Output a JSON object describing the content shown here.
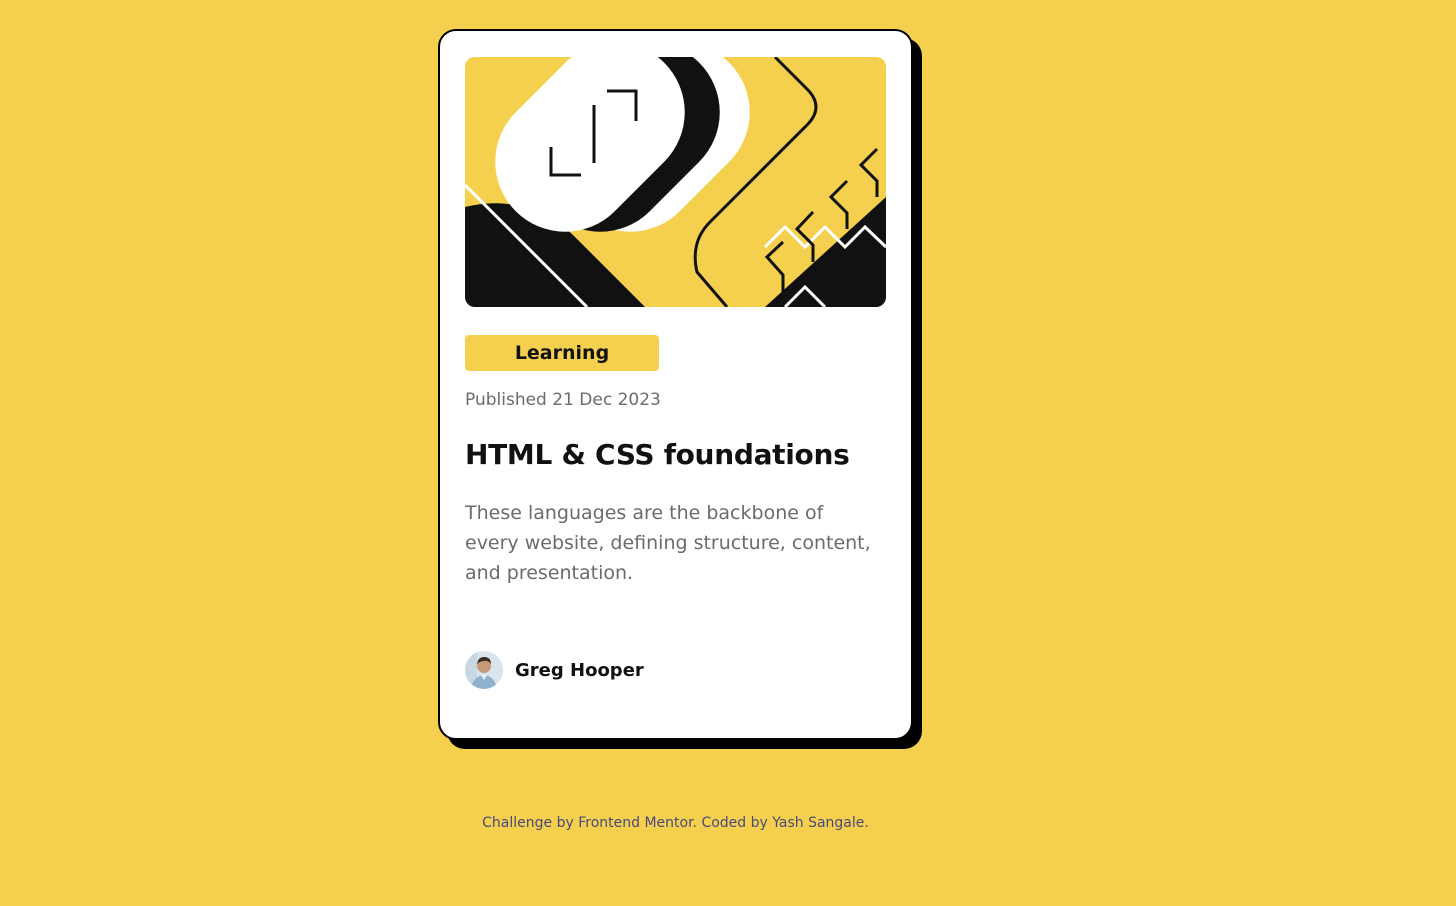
{
  "card": {
    "tag": "Learning",
    "published": "Published 21 Dec 2023",
    "title": "HTML & CSS foundations",
    "description": "These languages are the backbone of every website, defining structure, content, and presentation.",
    "author": {
      "name": "Greg Hooper",
      "avatar_icon": "person-avatar"
    },
    "illustration_icon": "abstract-illustration"
  },
  "footer": {
    "text": "Challenge by Frontend Mentor. Coded by Yash Sangale."
  },
  "colors": {
    "background": "#f4d04e",
    "card": "#ffffff",
    "text_dark": "#111111",
    "text_muted": "#6b6b6b",
    "shadow": "#000000"
  }
}
